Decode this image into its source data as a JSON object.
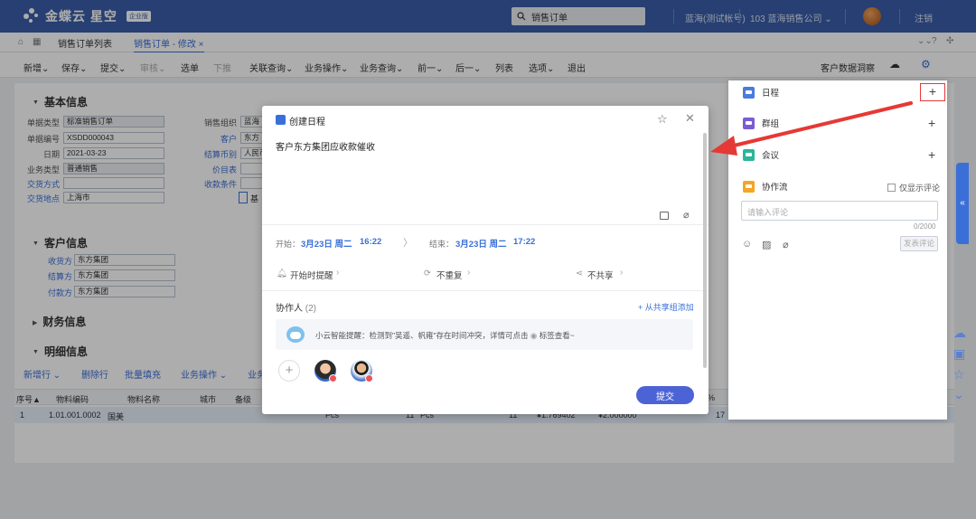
{
  "app": {
    "logo_text": "金蝶云 星空",
    "logo_badge": "企业版",
    "search_value": "销售订单",
    "user": "蓝海(测试帐号)",
    "org": "103 蓝海销售公司 ⌄",
    "logout": "注销"
  },
  "tabs": [
    {
      "label": "销售订单列表"
    },
    {
      "label": "销售订单 - 修改 ×"
    }
  ],
  "toolbar": {
    "items": [
      "新增⌄",
      "保存⌄",
      "提交⌄",
      "审核⌄",
      "选单",
      "下推",
      "关联查询⌄",
      "业务操作⌄",
      "业务查询⌄",
      "前一⌄",
      "后一⌄",
      "列表",
      "选项⌄",
      "退出"
    ],
    "right_label": "客户数据洞察"
  },
  "form": {
    "section_basic": "基本信息",
    "section_customer": "客户信息",
    "section_finance": "财务信息",
    "section_detail": "明细信息",
    "fields_left": [
      {
        "label": "单据类型",
        "value": "标准销售订单"
      },
      {
        "label": "单据编号",
        "value": "XSDD000043"
      },
      {
        "label": "日期",
        "value": "2021-03-23"
      },
      {
        "label": "业务类型",
        "value": "普通销售"
      },
      {
        "label": "交货方式",
        "value": ""
      },
      {
        "label": "交货地点",
        "value": "上海市"
      }
    ],
    "fields_mid": [
      {
        "label": "销售组织",
        "value": "蓝海"
      },
      {
        "label": "客户",
        "value": "东方"
      },
      {
        "label": "结算币别",
        "value": "人民币"
      },
      {
        "label": "价目表",
        "value": ""
      },
      {
        "label": "收款条件",
        "value": ""
      },
      {
        "label": "",
        "value": "基"
      }
    ],
    "customer_fields": [
      {
        "label": "收货方",
        "value": "东方集团"
      },
      {
        "label": "结算方",
        "value": "东方集团"
      },
      {
        "label": "付款方",
        "value": "东方集团"
      }
    ],
    "detail_toolbar": [
      "新增行 ⌄",
      "删除行",
      "批量填充",
      "业务操作 ⌄",
      "业务"
    ],
    "table_headers": [
      "序号▲",
      "物料编码",
      "物料名称",
      "城市",
      "备级"
    ],
    "table_row": {
      "seq": "1",
      "code": "1.01.001.0002",
      "name": "国美",
      "unit": "Pcs",
      "qty": "11",
      "unit2": "Pcs",
      "qty2": "11",
      "price": "¥1.769402",
      "amount": "¥2.000000",
      "rate": "17",
      "pct": "%"
    }
  },
  "modal": {
    "title": "创建日程",
    "content": "客户东方集团应收款催收",
    "start_label": "开始：",
    "start_date": "3月23日 周二",
    "start_time": "16:22",
    "end_label": "结束：",
    "end_date": "3月23日 周二",
    "end_time": "17:22",
    "remind": "开始时提醒",
    "repeat": "不重复",
    "share": "不共享",
    "collab_label": "协作人",
    "collab_count": "(2)",
    "add_from_share": "+ 从共享组添加",
    "tip": "小云智能提醒：检测到\"吴遥、帆雍\"存在时间冲突，详情可点击",
    "tip_link": "标签查看~",
    "submit": "提交"
  },
  "panel": {
    "items": [
      {
        "label": "日程",
        "color": "#4a7be0"
      },
      {
        "label": "群组",
        "color": "#7a5cd6"
      },
      {
        "label": "会议",
        "color": "#2bb59a"
      }
    ],
    "workflow_label": "协作流",
    "workflow_color": "#f5a623",
    "only_comments": "仅显示评论",
    "comment_placeholder": "请输入评论",
    "comment_count": "0/2000",
    "post_comment": "发表评论"
  }
}
